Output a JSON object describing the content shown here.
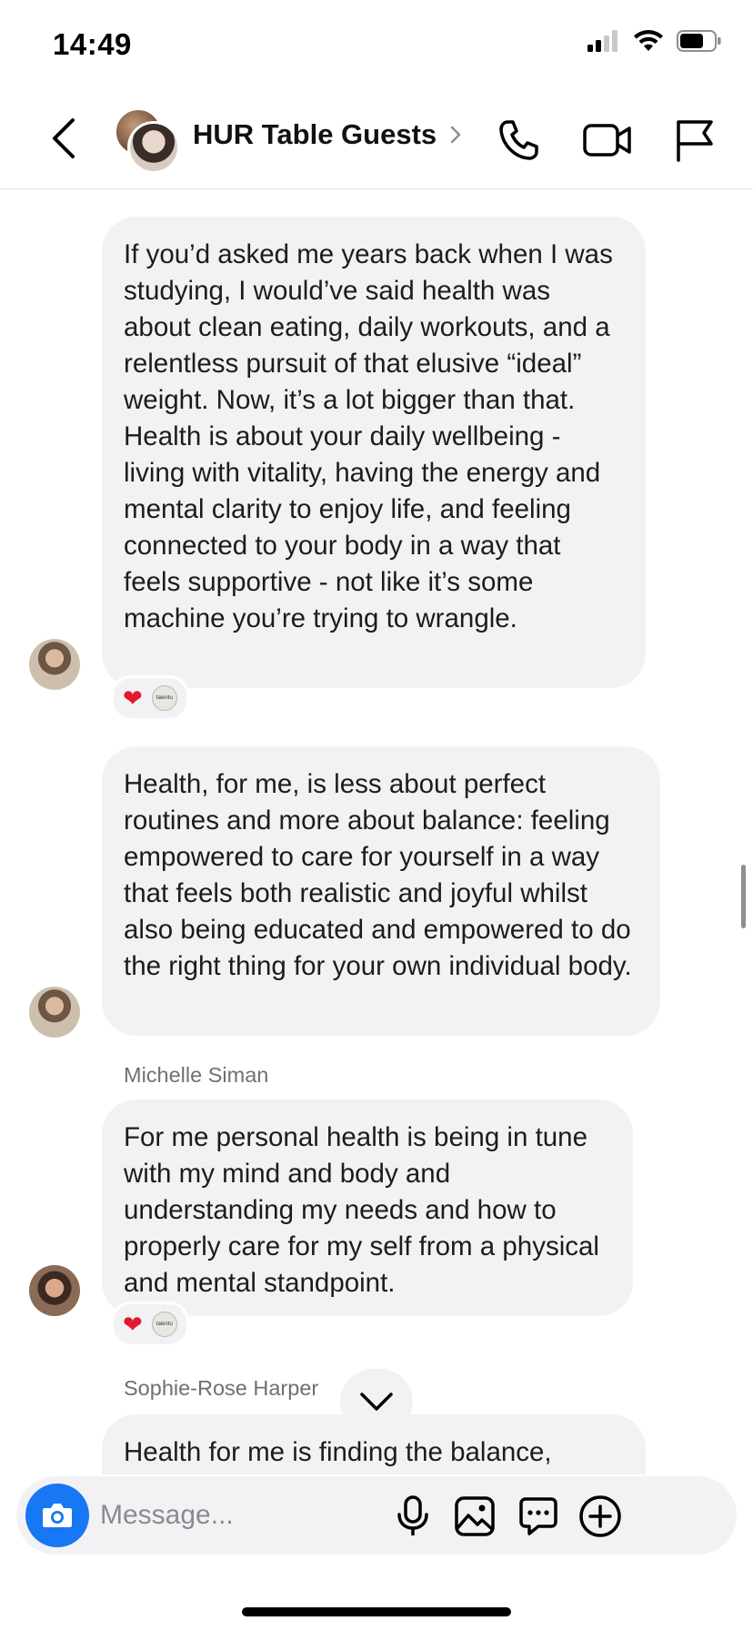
{
  "status_bar": {
    "time": "14:49"
  },
  "header": {
    "title": "HUR Table Guests"
  },
  "messages": [
    {
      "sender": "",
      "text": "If you’d asked me years back when I was studying, I would’ve said health was about clean eating, daily workouts, and a relentless pursuit of that elusive “ideal” weight. Now, it’s a lot bigger than that. Health is about your daily wellbeing - living with vitality, having the energy and mental clarity to enjoy life, and feeling connected to your body in a way that feels supportive - not like it’s some machine you’re trying to wrangle.",
      "reactions": [
        "heart",
        "avatar"
      ]
    },
    {
      "sender": "",
      "text": "Health, for me, is less about perfect routines and more about balance: feeling empowered to care for yourself in a way that feels both realistic and joyful whilst also being educated and empowered to do the right thing for your own individual body.",
      "reactions": []
    },
    {
      "sender": "Michelle Siman",
      "text": "For me personal health is being in tune with my mind and body and understanding my needs and how to properly care for my self from a physical and mental standpoint.",
      "reactions": [
        "heart",
        "avatar"
      ]
    },
    {
      "sender": "Sophie-Rose Harper",
      "text": "Health for me is finding the balance,",
      "reactions": []
    }
  ],
  "reaction_avatar_text": "talentu",
  "composer": {
    "placeholder": "Message..."
  },
  "colors": {
    "accent": "#1877f2",
    "bubble": "#f2f2f4",
    "heart": "#e0192d"
  }
}
